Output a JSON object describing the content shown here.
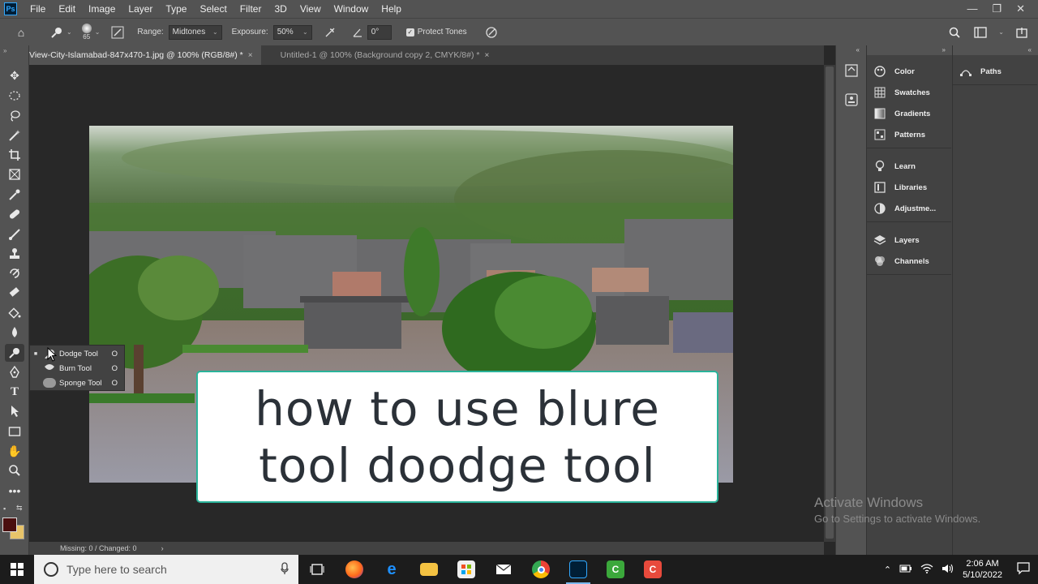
{
  "menubar": {
    "logo": "Ps",
    "items": [
      "File",
      "Edit",
      "Image",
      "Layer",
      "Type",
      "Select",
      "Filter",
      "3D",
      "View",
      "Window",
      "Help"
    ],
    "controls": [
      "—",
      "❐",
      "✕"
    ]
  },
  "options": {
    "brush_size": "65",
    "range_label": "Range:",
    "range_value": "Midtones",
    "exposure_label": "Exposure:",
    "exposure_value": "50%",
    "angle_value": "0°",
    "protect_tones_label": "Protect Tones",
    "protect_tones_checked": true
  },
  "tabs": [
    {
      "label": "View-City-Islamabad-847x470-1.jpg @ 100% (RGB/8#) *",
      "close": "×",
      "active": true
    },
    {
      "label": "Untitled-1 @ 100% (Background copy 2, CMYK/8#) *",
      "close": "×",
      "active": false
    }
  ],
  "flyout": {
    "items": [
      {
        "label": "Dodge Tool",
        "key": "O",
        "selected": true
      },
      {
        "label": "Burn Tool",
        "key": "O",
        "selected": false
      },
      {
        "label": "Sponge Tool",
        "key": "O",
        "selected": false
      }
    ]
  },
  "caption": {
    "line1": "how to use blure",
    "line2": "tool doodge tool"
  },
  "status": {
    "text": "Missing: 0 / Changed: 0",
    "arrow": "›"
  },
  "panels": {
    "group1": [
      {
        "label": "Color",
        "icon": "color-icon"
      },
      {
        "label": "Swatches",
        "icon": "swatches-icon"
      },
      {
        "label": "Gradients",
        "icon": "gradients-icon"
      },
      {
        "label": "Patterns",
        "icon": "patterns-icon"
      },
      {
        "label": "Learn",
        "icon": "learn-icon"
      },
      {
        "label": "Libraries",
        "icon": "libraries-icon"
      },
      {
        "label": "Adjustme...",
        "icon": "adjustments-icon"
      },
      {
        "label": "Layers",
        "icon": "layers-icon"
      },
      {
        "label": "Channels",
        "icon": "channels-icon"
      }
    ],
    "group2": [
      {
        "label": "Paths",
        "icon": "paths-icon"
      }
    ]
  },
  "watermark": {
    "line1": "Activate Windows",
    "line2": "Go to Settings to activate Windows."
  },
  "taskbar": {
    "search_placeholder": "Type here to search",
    "time": "2:06 AM",
    "date": "5/10/2022"
  },
  "colors": {
    "foreground": "#4a0f0f",
    "background": "#e8c46a",
    "caption_border": "#2ab39a"
  }
}
